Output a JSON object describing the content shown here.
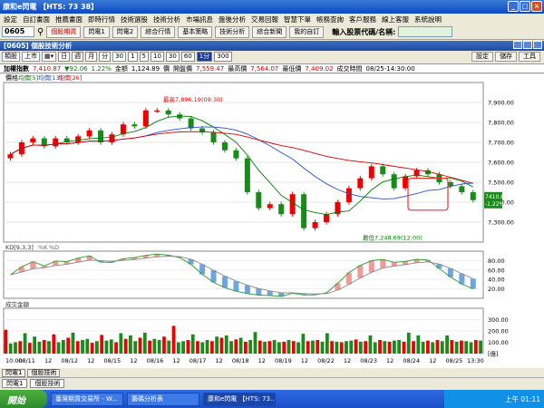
{
  "window": {
    "title": "康和e閃電 【HTS: 73 38】"
  },
  "menu": [
    "設定",
    "自訂畫面",
    "推薦畫面",
    "即時行情",
    "技術選股",
    "技術分析",
    "市場訊息",
    "盤後分析",
    "交易回報",
    "智慧下單",
    "帳務查詢",
    "客戶服務",
    "線上客服",
    "系統說明"
  ],
  "toolbar": {
    "code": "0605",
    "buttons": [
      "個股期貨",
      "閃電1",
      "閃電2",
      "綜合行情",
      "基本策略",
      "技術分析",
      "綜合新聞",
      "我的自訂"
    ],
    "search_label": "輸入股票代碼/名稱:"
  },
  "panel": {
    "title": "[0605] 個股技術分析"
  },
  "controls": {
    "type_select": "類股",
    "market_select": "上市",
    "period_options": [
      "日",
      "週",
      "月",
      "分"
    ],
    "period_value": "30",
    "minute_options": [
      "1",
      "5",
      "10",
      "30",
      "60",
      "1分",
      "300"
    ],
    "right_buttons": [
      "設定",
      "儲存",
      "工具"
    ]
  },
  "infobar": {
    "name": "加權指數",
    "price": "7,410.87",
    "change": "▼92.06",
    "pct": "1.22%",
    "amount_label": "金額",
    "amount": "1,124.89",
    "price_label": "價",
    "open_label": "開盤價",
    "open": "7,559.47",
    "high_label": "最高價",
    "high": "7,564.07",
    "low_label": "最低價",
    "low": "7,409.02",
    "time_label": "成交時間",
    "time": "08/25-14:30:00"
  },
  "chart_data": [
    {
      "type": "candlestick",
      "title": "價格",
      "legend": [
        "均價[5]",
        "均價[13]",
        "均價[26]"
      ],
      "ylim": [
        7200,
        8000
      ],
      "yticks": [
        "7,900.00",
        "7,800.00",
        "7,700.00",
        "7,600.00",
        "7,500.00",
        "7,400.00",
        "7,300.00"
      ],
      "annotations": [
        "最高7,896.19(09:30)",
        "最低7,248.69(12:00)"
      ],
      "last_price": "7410.87",
      "last_change": "-1.22%",
      "x": [
        "10:00",
        "08/11",
        "12",
        "08/12",
        "12",
        "08/15",
        "12",
        "08/16",
        "12",
        "08/17",
        "12",
        "08/18",
        "12",
        "08/19",
        "12",
        "08/22",
        "12",
        "08/23",
        "12",
        "08/24",
        "12",
        "08/25",
        "13:30"
      ],
      "close": [
        7640,
        7700,
        7720,
        7680,
        7720,
        7700,
        7730,
        7760,
        7700,
        7740,
        7790,
        7780,
        7860,
        7860,
        7840,
        7820,
        7770,
        7750,
        7700,
        7660,
        7620,
        7450,
        7370,
        7390,
        7340,
        7440,
        7270,
        7300,
        7340,
        7400,
        7470,
        7520,
        7580,
        7540,
        7470,
        7530,
        7560,
        7540,
        7500,
        7480,
        7450,
        7410
      ]
    },
    {
      "type": "line",
      "title": "KD[9,3,3]",
      "legend": [
        "%K",
        "%D"
      ],
      "ylim": [
        0,
        100
      ],
      "yticks": [
        "80.00",
        "60.00",
        "40.00",
        "20.00"
      ]
    },
    {
      "type": "bar",
      "title": "成交金額",
      "ylim": [
        0,
        400
      ],
      "yticks": [
        "300.00",
        "200.00",
        "100.00",
        "[億]"
      ],
      "values": [
        210,
        90,
        100,
        110,
        180,
        95,
        150,
        105,
        120,
        110,
        170,
        100,
        120,
        140,
        185,
        110,
        120,
        130,
        95,
        110,
        165,
        115,
        125,
        100,
        180,
        130,
        160,
        110,
        140,
        185,
        115,
        130,
        120,
        150,
        115,
        245,
        100,
        110,
        120,
        170,
        110,
        100,
        120,
        110,
        150,
        140,
        160,
        110,
        125,
        140,
        105,
        120,
        190,
        115,
        105,
        110,
        120,
        100,
        105,
        120,
        110,
        100,
        175,
        110,
        115,
        120,
        105,
        180,
        110,
        105,
        100,
        110,
        115,
        125,
        105,
        110,
        160,
        100,
        120,
        110,
        105,
        115,
        120,
        105,
        185,
        110,
        160,
        105,
        115,
        100,
        120,
        110,
        160,
        120,
        105,
        115,
        110,
        100,
        120,
        115
      ]
    }
  ],
  "bottom_tabs": [
    "閃電1",
    "個股技術"
  ],
  "status_tabs": [
    "閃電1",
    "個股技術"
  ],
  "taskbar": {
    "start": "開始",
    "tasks": [
      "臺灣期貨交易所 - W...",
      "籌碼分析表",
      "康和e閃電 【HTS: 73..."
    ],
    "clock": "上午 01:11"
  }
}
